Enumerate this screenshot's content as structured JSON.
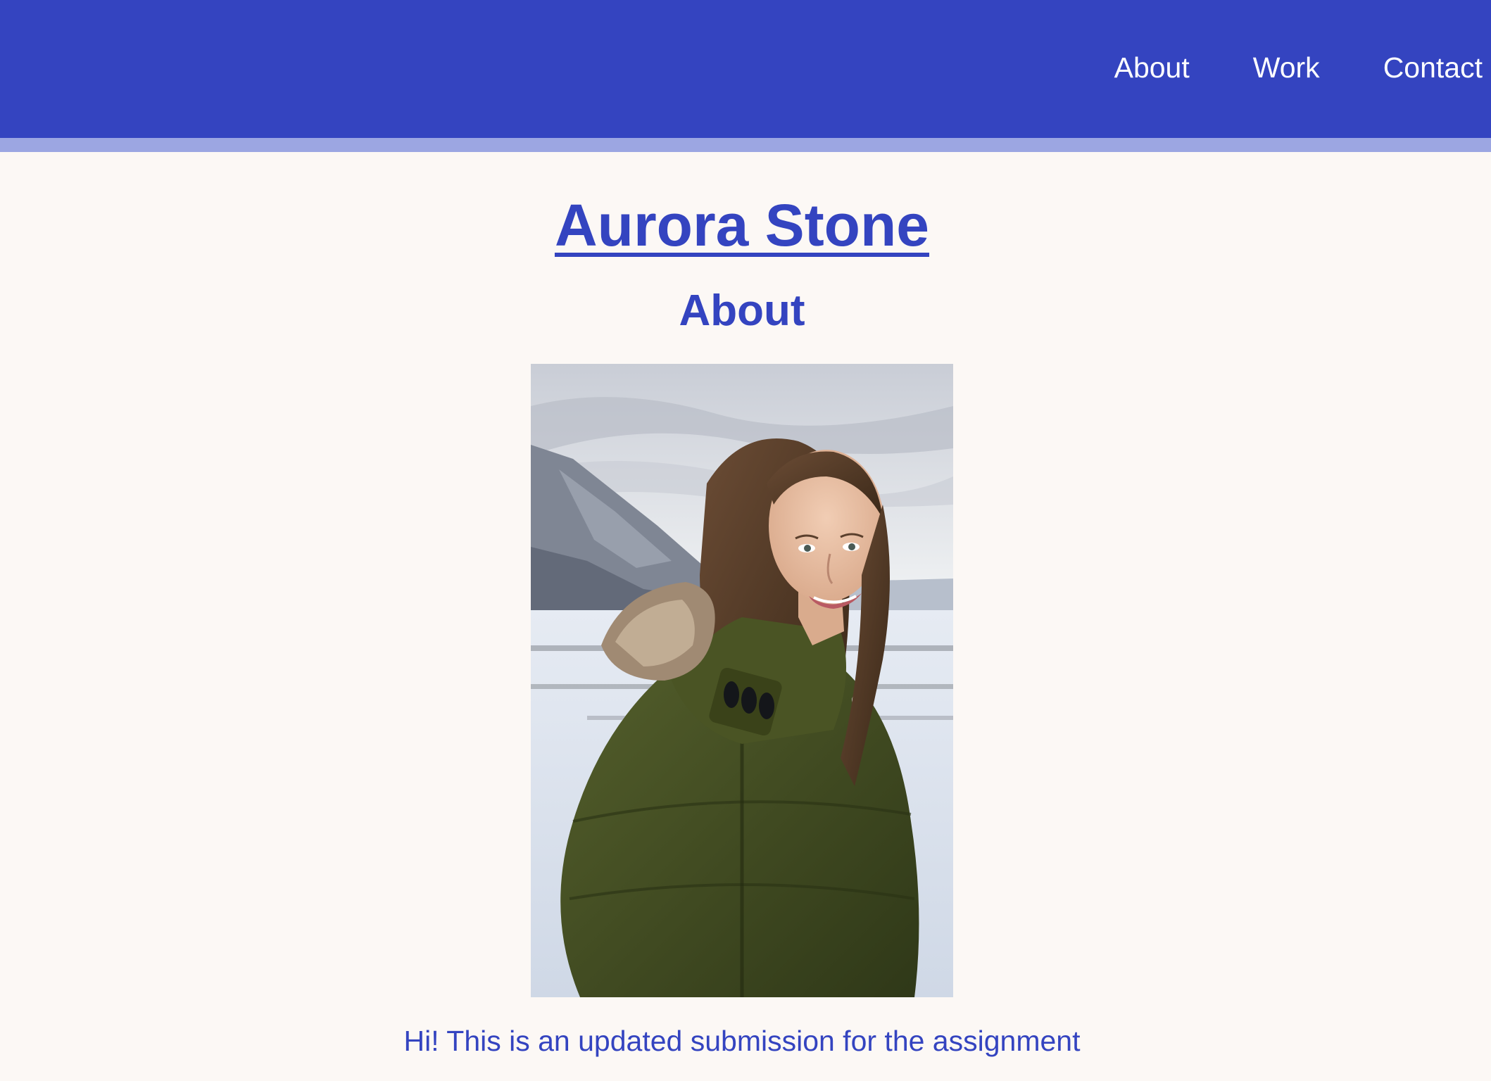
{
  "nav": {
    "items": [
      {
        "label": "About"
      },
      {
        "label": "Work"
      },
      {
        "label": "Contact"
      }
    ]
  },
  "site_title": "Aurora Stone",
  "section": {
    "heading": "About",
    "intro": "Hi! This is an updated submission for the assignment"
  },
  "colors": {
    "header_bg": "#3444c0",
    "header_stripe": "#9ca6e2",
    "page_bg": "#fcf8f5",
    "text_accent": "#3444c0"
  }
}
